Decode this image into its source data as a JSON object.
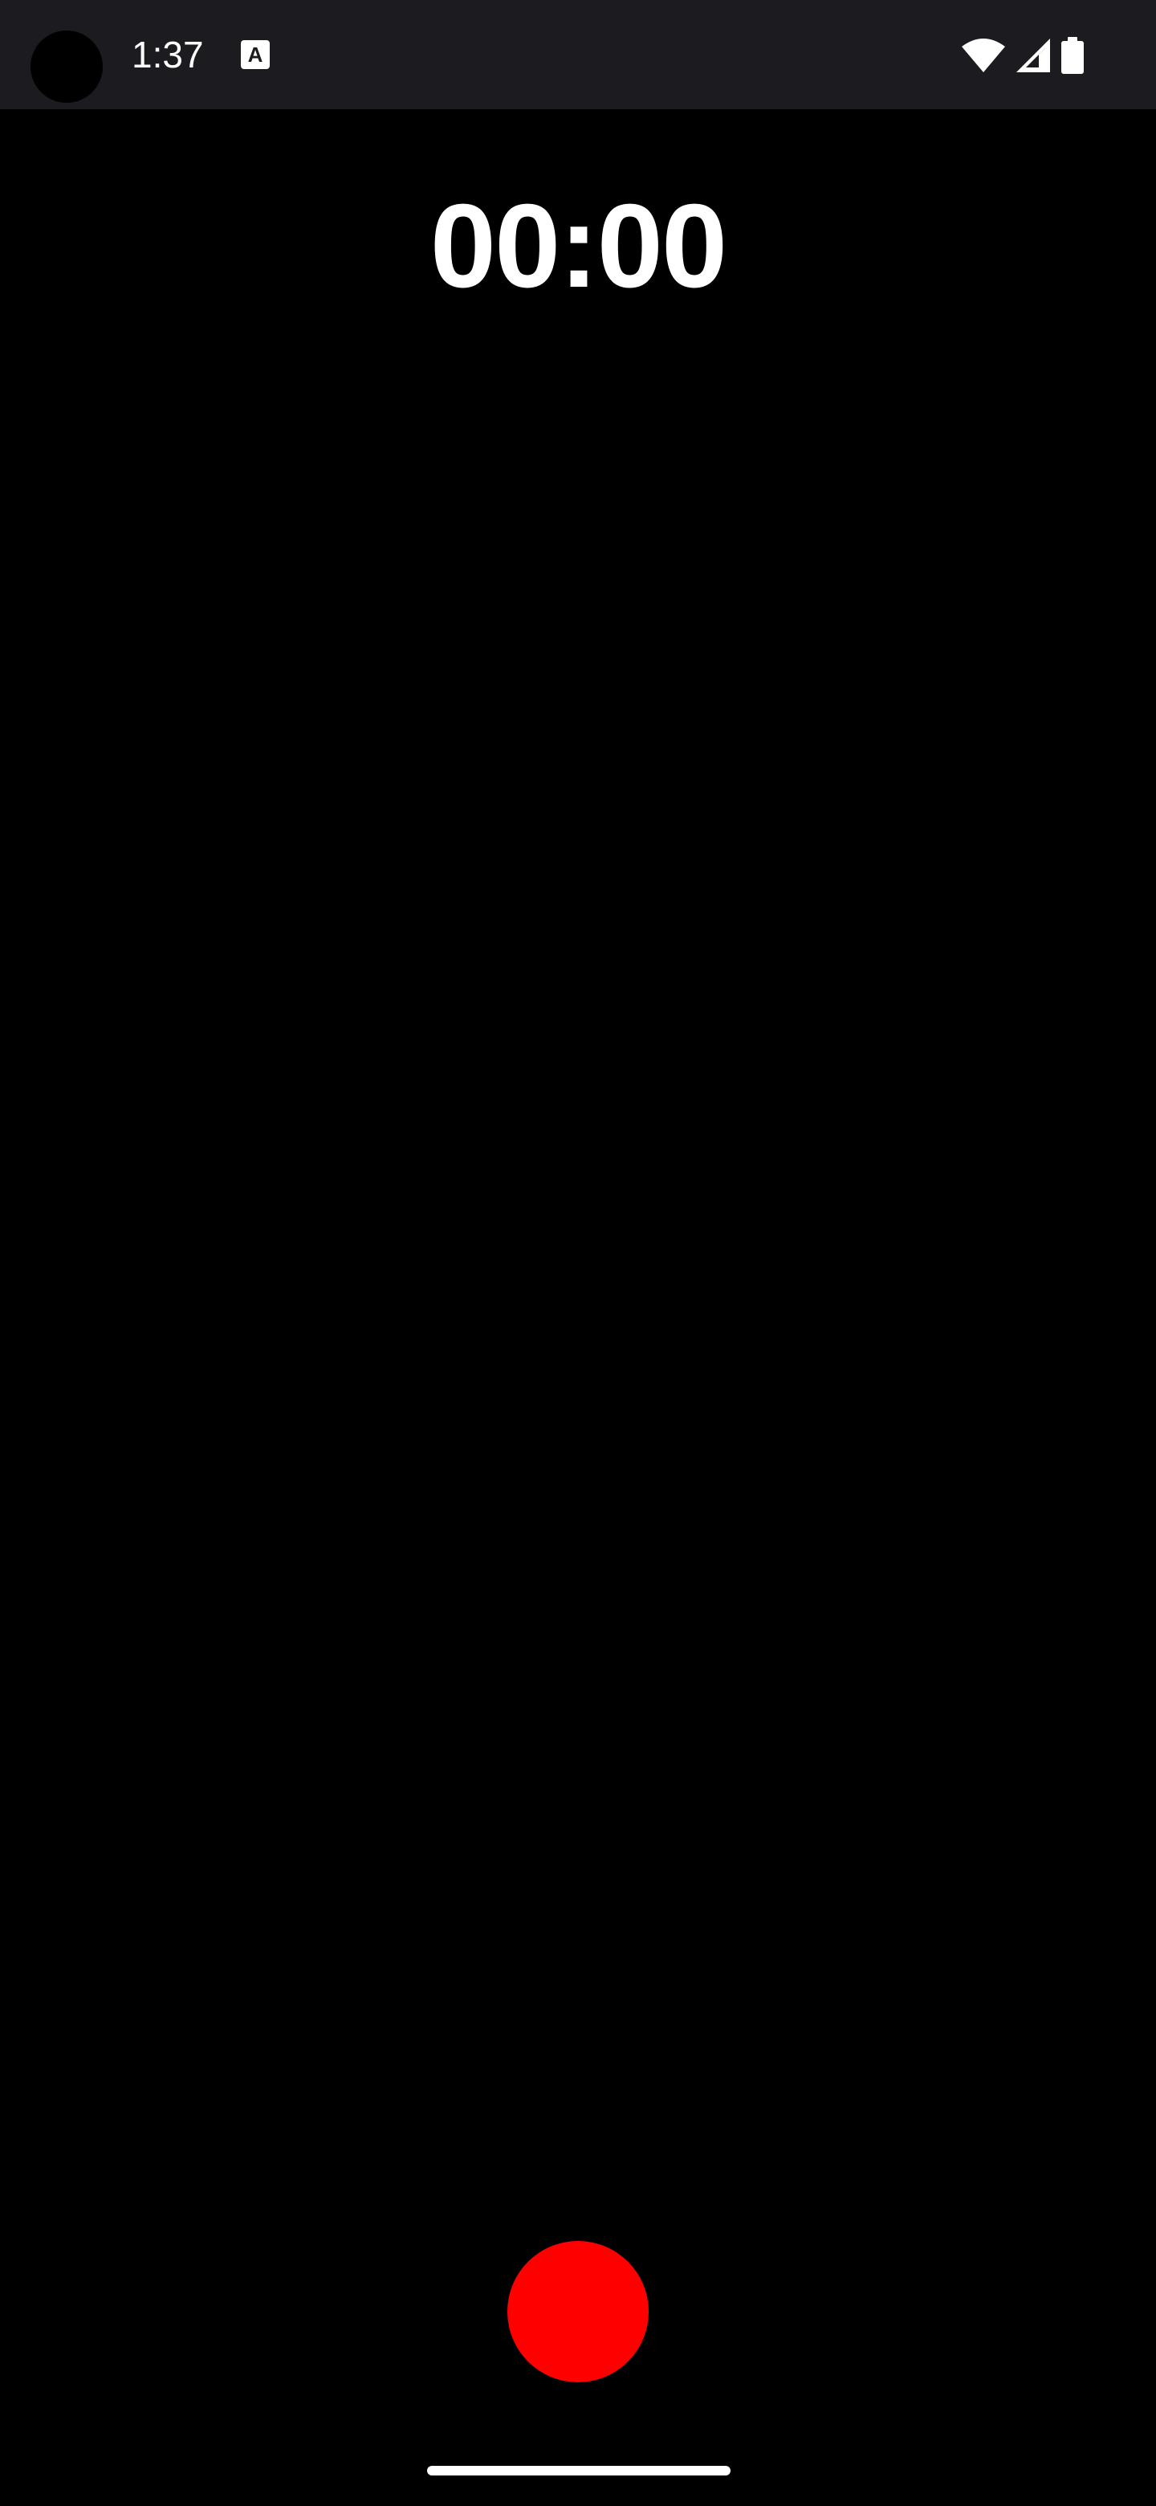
{
  "status_bar": {
    "time": "1:37",
    "notification_glyph": "A",
    "icons": [
      "wifi-icon",
      "cellular-signal-icon",
      "battery-icon"
    ]
  },
  "recorder": {
    "elapsed": "00:00",
    "record_button_color": "#ff0000"
  },
  "colors": {
    "background": "#000000",
    "status_bar": "#1b1b20",
    "text": "#ffffff"
  }
}
